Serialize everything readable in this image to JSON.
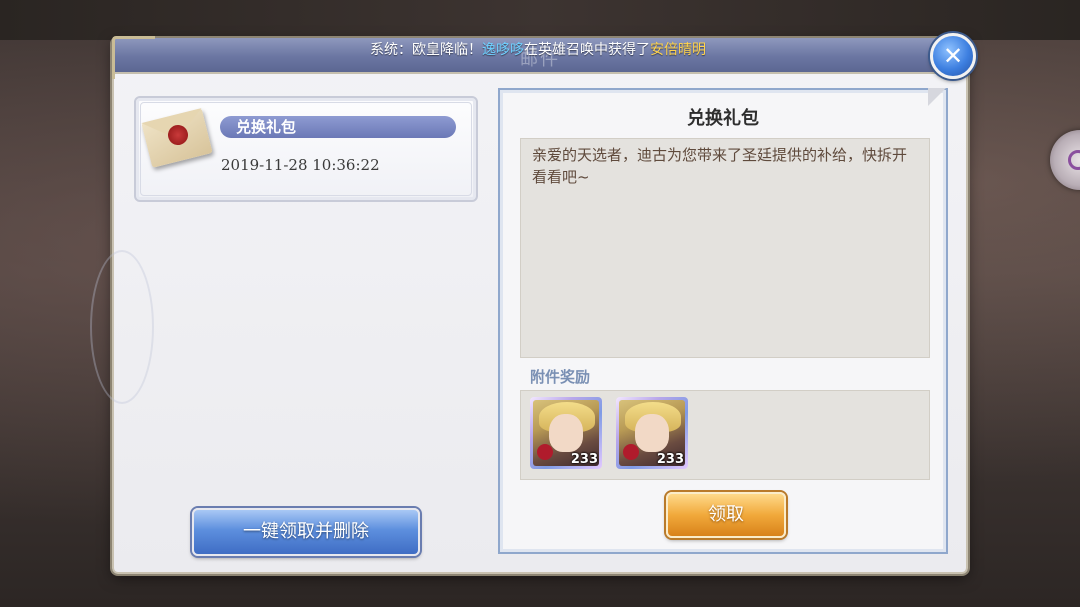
{
  "announcement": {
    "prefix": "系统：欧皇降临！",
    "player": "逸哆哆",
    "middle": "在英雄召唤中获得了",
    "hero": "安倍晴明"
  },
  "window": {
    "title": "邮件"
  },
  "mail_list": [
    {
      "title": "兑换礼包",
      "date": "2019-11-28  10:36:22",
      "icon": "envelope-icon"
    }
  ],
  "batch_claim_label": "一键领取并删除",
  "detail": {
    "title": "兑换礼包",
    "message": "亲爱的天选者，迪古为您带来了圣廷提供的补给，快拆开看看吧~",
    "attachments_label": "附件奖励",
    "rewards": [
      {
        "icon": "hero-portrait-icon",
        "count": "233"
      },
      {
        "icon": "hero-portrait-icon",
        "count": "233"
      }
    ],
    "claim_label": "领取"
  },
  "colors": {
    "header": "#6b76a2",
    "player_highlight": "#6fd0ff",
    "hero_highlight": "#ffd34d",
    "claim_button": "#f1a93b",
    "batch_button": "#5d8fde"
  }
}
